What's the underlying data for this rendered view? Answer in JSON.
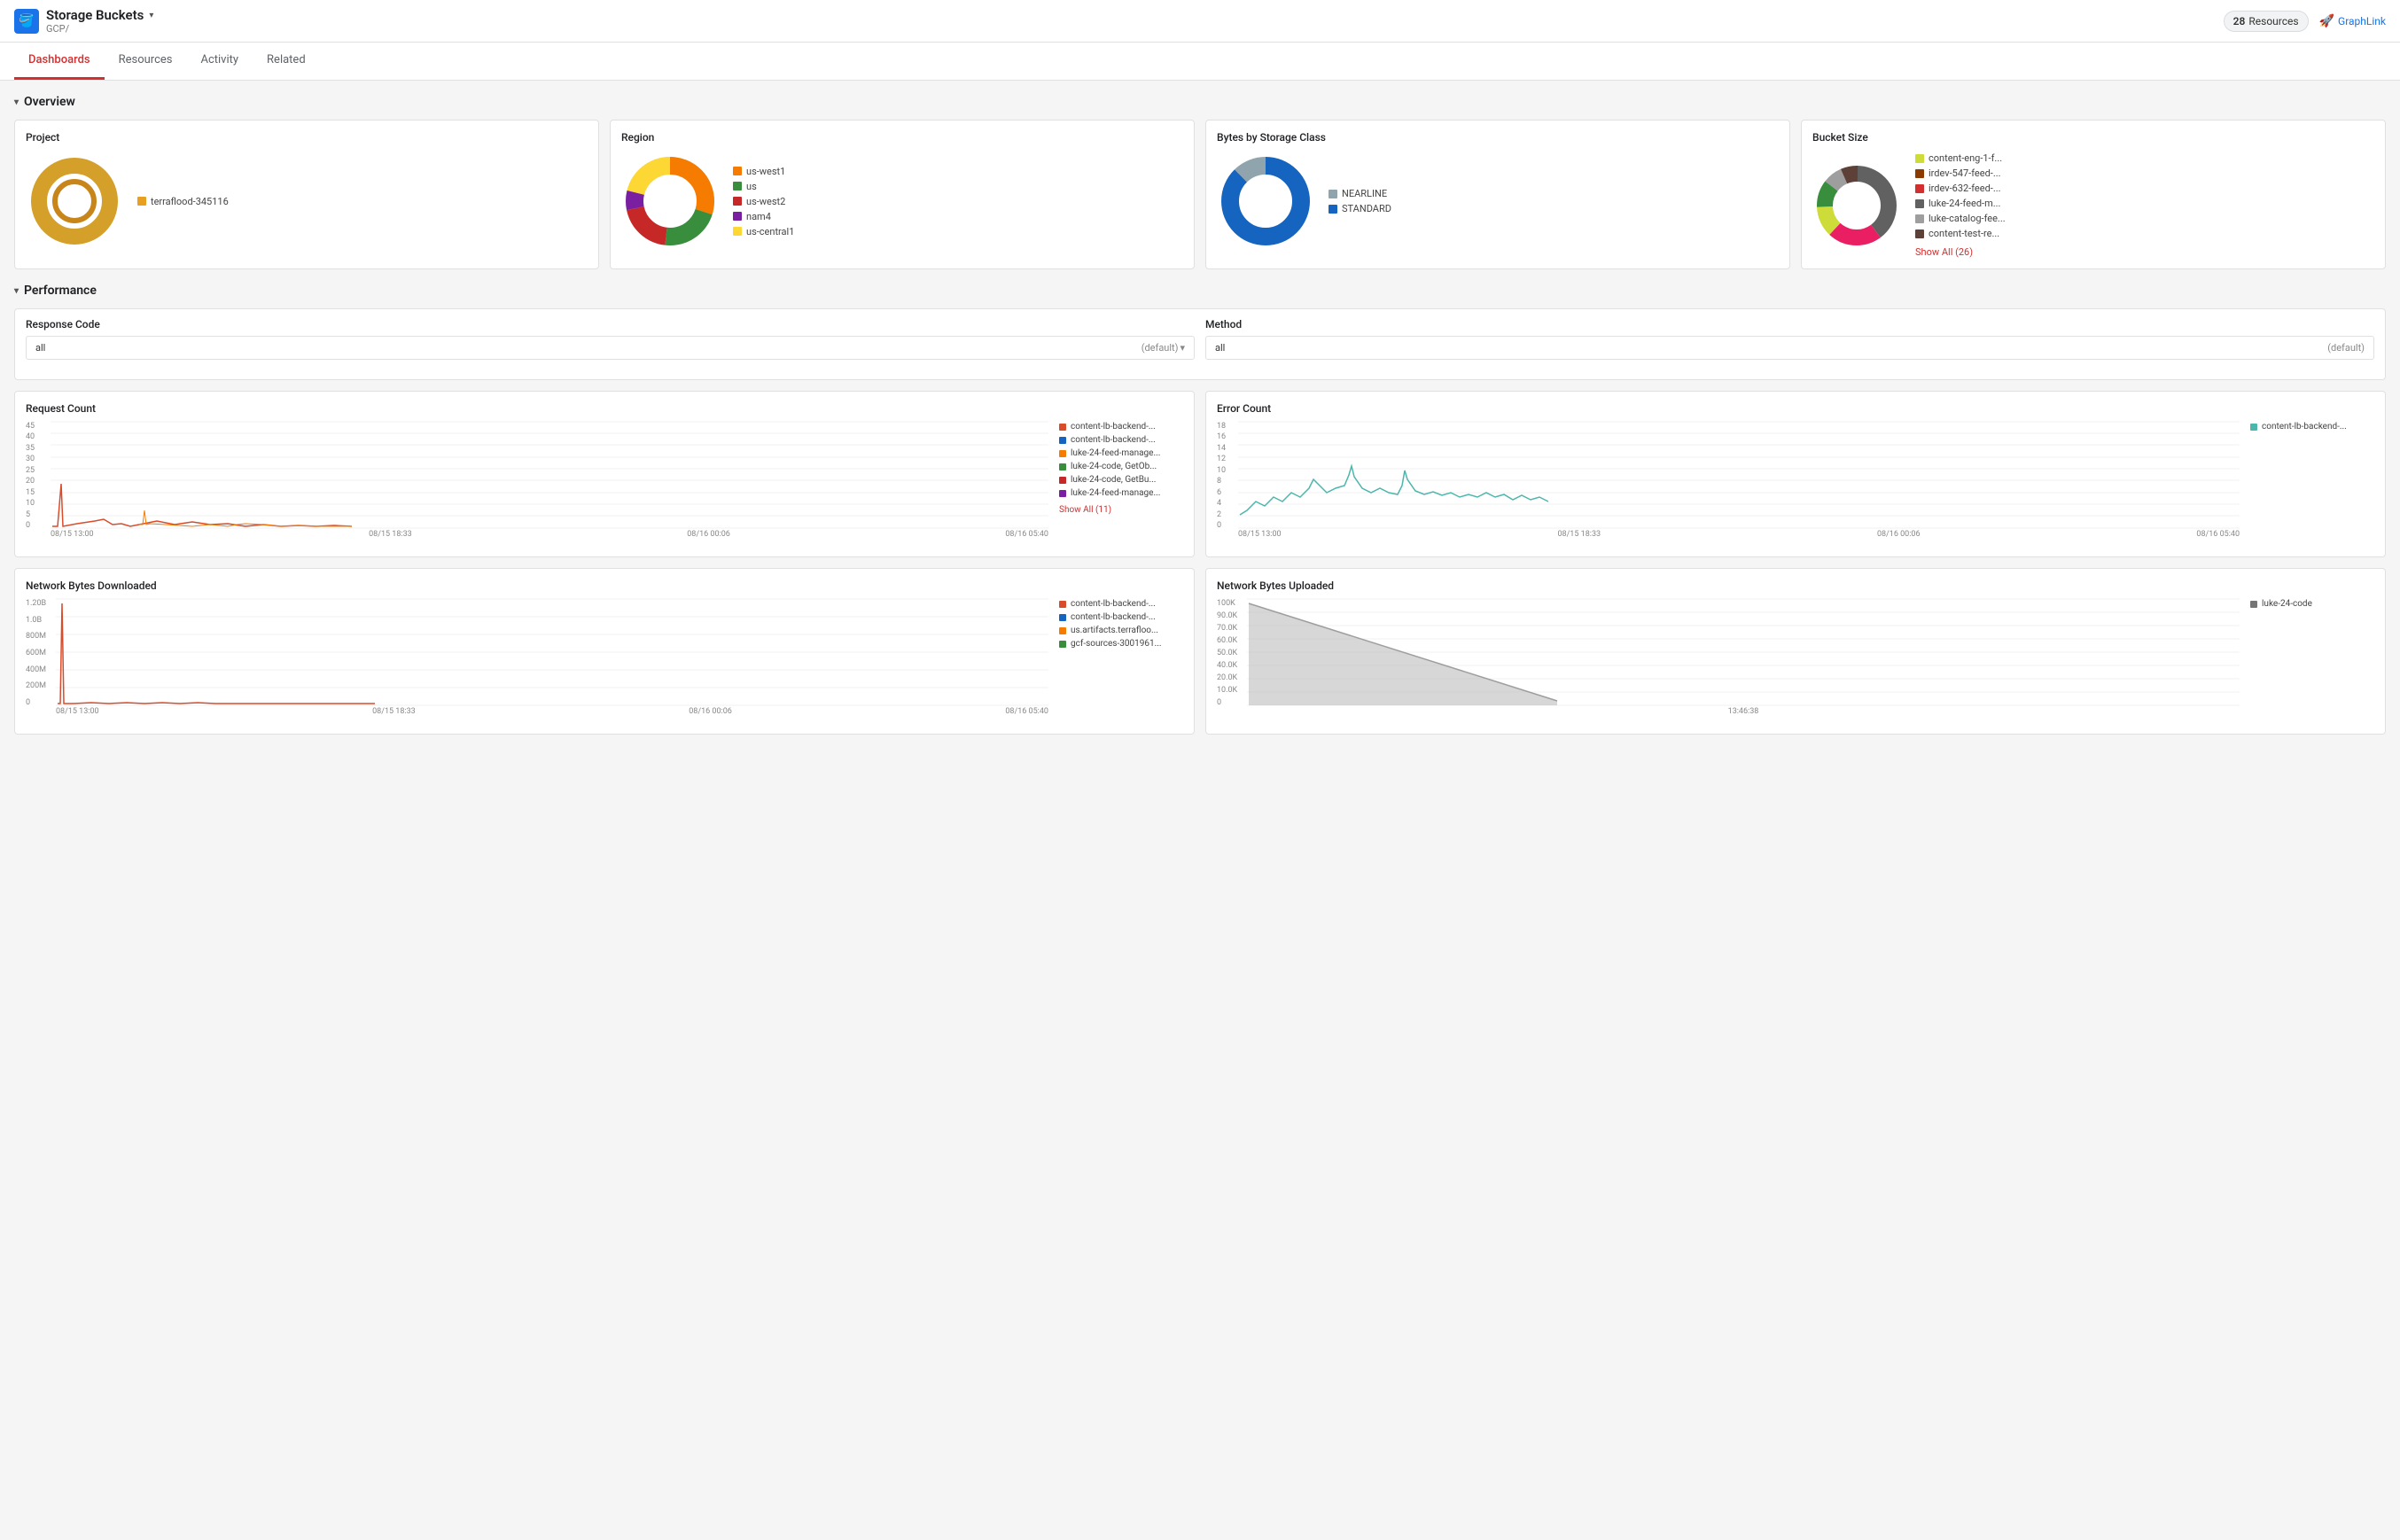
{
  "header": {
    "icon": "🪣",
    "title": "Storage Buckets",
    "subtitle": "GCP/",
    "resources_count": "28",
    "resources_label": "Resources",
    "graphlink_label": "GraphLink"
  },
  "nav": {
    "tabs": [
      {
        "id": "dashboards",
        "label": "Dashboards",
        "active": true
      },
      {
        "id": "resources",
        "label": "Resources",
        "active": false
      },
      {
        "id": "activity",
        "label": "Activity",
        "active": false
      },
      {
        "id": "related",
        "label": "Related",
        "active": false
      }
    ]
  },
  "overview": {
    "title": "Overview",
    "project": {
      "title": "Project",
      "legend": [
        {
          "label": "terraflood-345116",
          "color": "#e8a020"
        }
      ]
    },
    "region": {
      "title": "Region",
      "legend": [
        {
          "label": "us-west1",
          "color": "#f57c00"
        },
        {
          "label": "us",
          "color": "#388e3c"
        },
        {
          "label": "us-west2",
          "color": "#c62828"
        },
        {
          "label": "nam4",
          "color": "#7b1fa2"
        },
        {
          "label": "us-central1",
          "color": "#fdd835"
        }
      ]
    },
    "bytes_by_storage_class": {
      "title": "Bytes by Storage Class",
      "legend": [
        {
          "label": "NEARLINE",
          "color": "#c0c0c0"
        },
        {
          "label": "STANDARD",
          "color": "#1565c0"
        }
      ]
    },
    "bucket_size": {
      "title": "Bucket Size",
      "legend": [
        {
          "label": "content-eng-1-f...",
          "color": "#cddc39"
        },
        {
          "label": "irdev-547-feed-...",
          "color": "#8b3a00"
        },
        {
          "label": "irdev-632-feed-...",
          "color": "#d32f2f"
        },
        {
          "label": "luke-24-feed-m...",
          "color": "#616161"
        },
        {
          "label": "luke-catalog-fee...",
          "color": "#9e9e9e"
        },
        {
          "label": "content-test-re...",
          "color": "#5d4037"
        }
      ],
      "show_all": "Show All (26)"
    }
  },
  "performance": {
    "title": "Performance",
    "response_code": {
      "label": "Response Code",
      "value": "all",
      "default": "(default)"
    },
    "method": {
      "label": "Method",
      "value": "all",
      "default": "(default)"
    },
    "request_count": {
      "title": "Request Count",
      "y_labels": [
        "45",
        "40",
        "35",
        "30",
        "25",
        "20",
        "15",
        "10",
        "5",
        "0"
      ],
      "x_labels": [
        "08/15 13:00",
        "08/15 18:33",
        "08/16 00:06",
        "08/16 05:40"
      ],
      "legend": [
        {
          "label": "content-lb-backend-...",
          "color": "#d94c2b"
        },
        {
          "label": "content-lb-backend-...",
          "color": "#1565c0"
        },
        {
          "label": "luke-24-feed-manage...",
          "color": "#f57c00"
        },
        {
          "label": "luke-24-code, GetOb...",
          "color": "#388e3c"
        },
        {
          "label": "luke-24-code, GetBu...",
          "color": "#c62828"
        },
        {
          "label": "luke-24-feed-manage...",
          "color": "#7b1fa2"
        }
      ],
      "show_all": "Show All (11)"
    },
    "error_count": {
      "title": "Error Count",
      "y_labels": [
        "18",
        "16",
        "14",
        "12",
        "10",
        "8",
        "6",
        "4",
        "2",
        "0"
      ],
      "x_labels": [
        "08/15 13:00",
        "08/15 18:33",
        "08/16 00:06",
        "08/16 05:40"
      ],
      "legend": [
        {
          "label": "content-lb-backend-...",
          "color": "#4db6ac"
        }
      ]
    },
    "network_bytes_downloaded": {
      "title": "Network Bytes Downloaded",
      "y_labels": [
        "1.20B",
        "1.0B",
        "800M",
        "600M",
        "400M",
        "200M",
        "0"
      ],
      "x_labels": [
        "08/15 13:00",
        "08/15 18:33",
        "08/16 00:06",
        "08/16 05:40"
      ],
      "legend": [
        {
          "label": "content-lb-backend-...",
          "color": "#d94c2b"
        },
        {
          "label": "content-lb-backend-...",
          "color": "#1565c0"
        },
        {
          "label": "us.artifacts.terrafloo...",
          "color": "#f57c00"
        },
        {
          "label": "gcf-sources-3001961...",
          "color": "#388e3c"
        }
      ]
    },
    "network_bytes_uploaded": {
      "title": "Network Bytes Uploaded",
      "y_labels": [
        "100K",
        "90.0K",
        "70.0K",
        "60.0K",
        "50.0K",
        "40.0K",
        "20.0K",
        "10.0K",
        "0"
      ],
      "x_labels": [
        "13:46:38"
      ],
      "legend": [
        {
          "label": "luke-24-code",
          "color": "#757575"
        }
      ]
    }
  }
}
